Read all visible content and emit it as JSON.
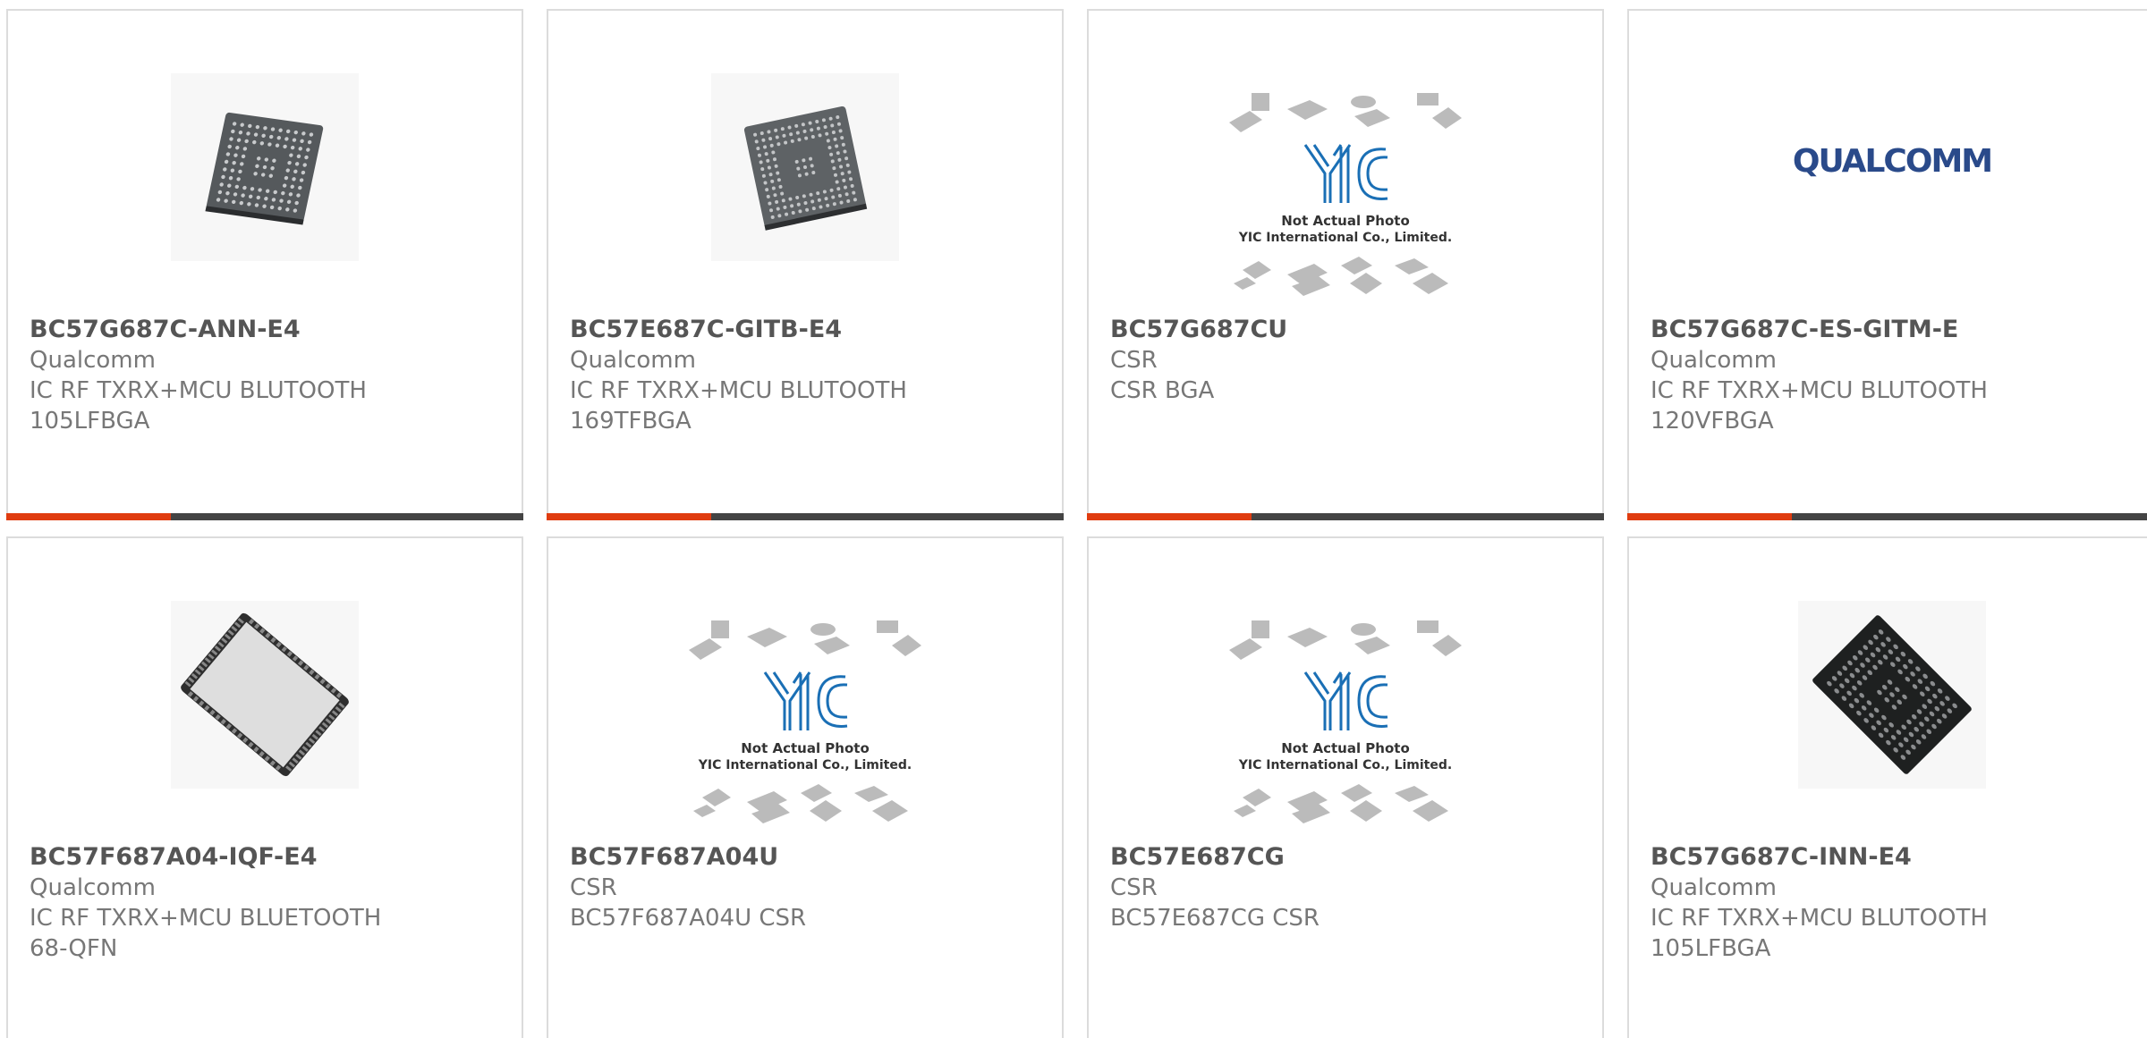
{
  "products": [
    {
      "part_number": "BC57G687C-ANN-E4",
      "manufacturer": "Qualcomm",
      "lines": [
        "IC RF TXRX+MCU BLUTOOTH",
        "105LFBGA"
      ],
      "image": "bga-chip-grey"
    },
    {
      "part_number": "BC57E687C-GITB-E4",
      "manufacturer": "Qualcomm",
      "lines": [
        "IC RF TXRX+MCU BLUTOOTH",
        "169TFBGA"
      ],
      "image": "bga-chip-grey"
    },
    {
      "part_number": "BC57G687CU",
      "manufacturer": "CSR",
      "lines": [
        "CSR BGA",
        ""
      ],
      "image": "yic-placeholder",
      "placeholder_text": [
        "Not Actual Photo",
        "YIC International Co., Limited."
      ]
    },
    {
      "part_number": "BC57G687C-ES-GITM-E",
      "manufacturer": "Qualcomm",
      "lines": [
        "IC RF TXRX+MCU BLUTOOTH",
        "120VFBGA"
      ],
      "image": "qualcomm-logo",
      "logo_text": "QUALCOMM"
    },
    {
      "part_number": "BC57F687A04-IQF-E4",
      "manufacturer": "Qualcomm",
      "lines": [
        "IC RF TXRX+MCU BLUETOOTH",
        "68-QFN"
      ],
      "image": "qfn-chip"
    },
    {
      "part_number": "BC57F687A04U",
      "manufacturer": "CSR",
      "lines": [
        "BC57F687A04U CSR",
        ""
      ],
      "image": "yic-placeholder",
      "placeholder_text": [
        "Not Actual Photo",
        "YIC International Co., Limited."
      ]
    },
    {
      "part_number": "BC57E687CG",
      "manufacturer": "CSR",
      "lines": [
        "BC57E687CG CSR",
        ""
      ],
      "image": "yic-placeholder",
      "placeholder_text": [
        "Not Actual Photo",
        "YIC International Co., Limited."
      ]
    },
    {
      "part_number": "BC57G687C-INN-E4",
      "manufacturer": "Qualcomm",
      "lines": [
        "IC RF TXRX+MCU BLUTOOTH",
        "105LFBGA"
      ],
      "image": "bga-chip-black"
    }
  ],
  "colors": {
    "accent_bar": "#e03c10",
    "dark_bar": "#444444",
    "yic_blue": "#1a6fb5",
    "qualcomm_blue": "#2a4a8a"
  }
}
